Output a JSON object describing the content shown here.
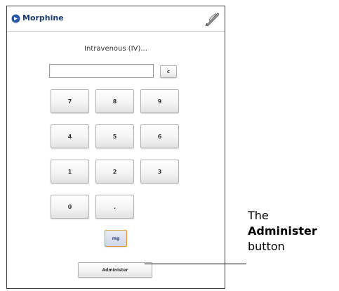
{
  "window": {
    "title": "Morphine",
    "title_icon": "circle-arrow-icon",
    "tool_icon": "feather-pen-icon"
  },
  "form": {
    "route_label": "Intravenous (IV)...",
    "dose_value": "",
    "clear_label": "c",
    "keys": [
      "7",
      "8",
      "9",
      "4",
      "5",
      "6",
      "1",
      "2",
      "3",
      "0",
      "."
    ],
    "unit_label": "mg",
    "administer_label": "Administer"
  },
  "callout": {
    "line1": "The",
    "line2": "Administer",
    "line3": "button"
  },
  "colors": {
    "title_text": "#1e3b6e",
    "unit_border": "#d8962e"
  }
}
